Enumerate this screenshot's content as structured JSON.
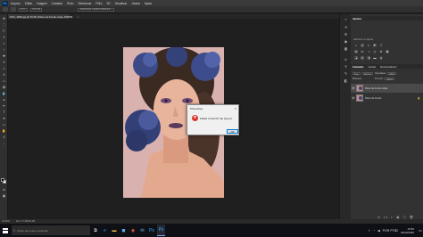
{
  "app": {
    "logo_text": "Ps",
    "menu": [
      "Arquivo",
      "Editar",
      "Imagem",
      "Camada",
      "Texto",
      "Selecionar",
      "Filtro",
      "3D",
      "Visualizar",
      "Janela",
      "Ajuda"
    ]
  },
  "options_bar": {
    "mode_value": "Nova seleção",
    "feather_value": "0 px",
    "style_value": "Normal",
    "select_mask_label": "Selecionar e Aplicar Máscara..."
  },
  "document": {
    "tab_title": "DSC_4990.jpg @ 33,3% (Plano de Fundo cópia, RGB/8)",
    "tab_close": "×"
  },
  "status": {
    "zoom": "33,33%",
    "doc_info": "Doc: 17,2M/34,4M"
  },
  "dialog": {
    "title": "Photoshop",
    "close": "×",
    "icon": "error-icon",
    "message": "Failed to launch the plug-in.",
    "ok_label": "OK"
  },
  "panels": {
    "adjustments": {
      "tab": "Ajustes",
      "subtitle": "Adicionar um ajuste"
    },
    "layers": {
      "tabs": [
        "Camadas",
        "Canais",
        "Demarcadores"
      ],
      "filter_label": "Tipo",
      "blend_mode": "Normal",
      "opacity_label": "Opacidade:",
      "opacity_value": "100%",
      "lock_label": "Bloquear:",
      "fill_label": "Preench.:",
      "fill_value": "100%",
      "items": [
        {
          "name": "Plano de Fundo cópia",
          "selected": true,
          "locked": false
        },
        {
          "name": "Plano de Fundo",
          "selected": false,
          "locked": true
        }
      ],
      "footer_icons": "⊖ fx ◐ ▣ ▢ 🗑"
    }
  },
  "taskbar": {
    "search_placeholder": "Digite aqui para pesquisar",
    "time": "15:50",
    "date": "26/03/2020",
    "lang": "POR PTB2"
  },
  "colors": {
    "ps_blue": "#31a8ff",
    "dialog_error": "#d9342b",
    "selected_layer": "#4a4a4a"
  }
}
